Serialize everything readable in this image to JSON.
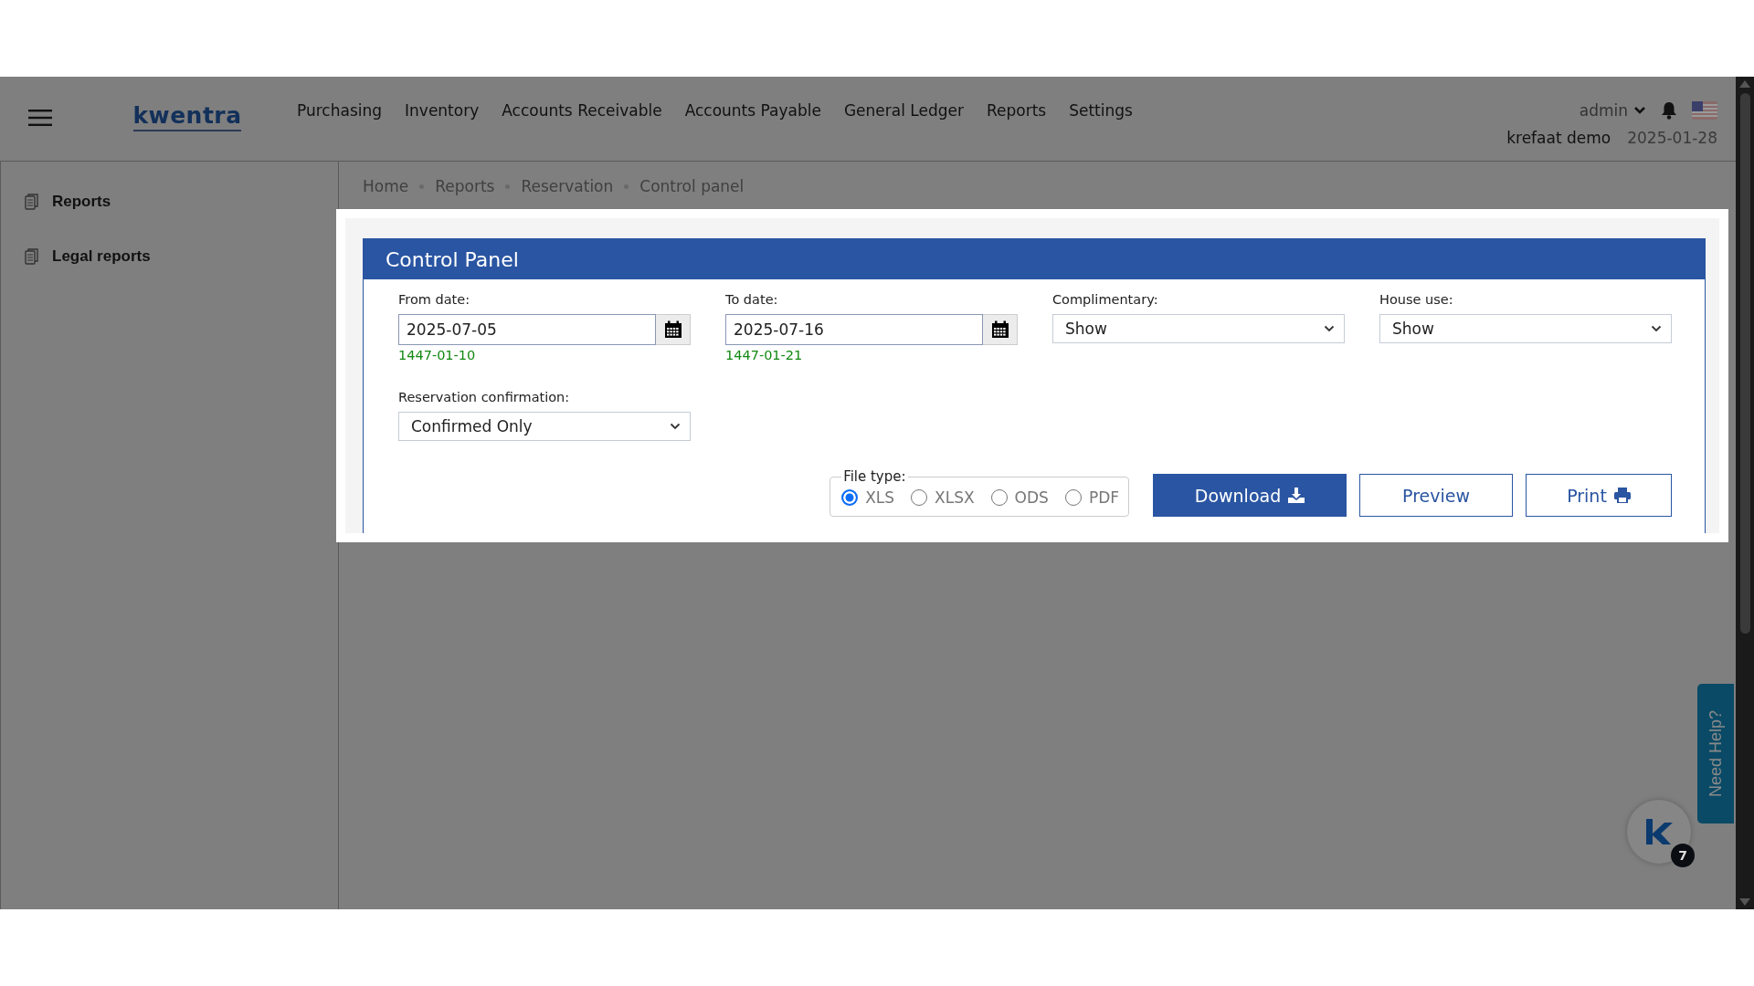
{
  "header": {
    "brand": "kwentra",
    "nav": [
      "Purchasing",
      "Inventory",
      "Accounts Receivable",
      "Accounts Payable",
      "General Ledger",
      "Reports",
      "Settings"
    ],
    "user": "admin",
    "company": "krefaat demo",
    "date": "2025-01-28"
  },
  "sidebar": {
    "items": [
      {
        "label": "Reports"
      },
      {
        "label": "Legal reports"
      }
    ]
  },
  "breadcrumb": [
    "Home",
    "Reports",
    "Reservation",
    "Control panel"
  ],
  "panel": {
    "title": "Control Panel",
    "date_fields": [
      {
        "label": "From date:",
        "value": "2025-07-05",
        "hijri": "1447-01-10"
      },
      {
        "label": "To date:",
        "value": "2025-07-16",
        "hijri": "1447-01-21"
      }
    ],
    "selects": [
      {
        "label": "Complimentary:",
        "value": "Show"
      },
      {
        "label": "House use:",
        "value": "Show"
      }
    ],
    "reservation_confirmation": {
      "label": "Reservation confirmation:",
      "value": "Confirmed Only"
    },
    "file_type": {
      "legend": "File type:",
      "options": [
        {
          "label": "XLS",
          "selected": true
        },
        {
          "label": "XLSX",
          "selected": false
        },
        {
          "label": "ODS",
          "selected": false
        },
        {
          "label": "PDF",
          "selected": false
        }
      ]
    },
    "buttons": [
      {
        "label": "Download",
        "kind": "download"
      },
      {
        "label": "Preview",
        "kind": "preview"
      },
      {
        "label": "Print",
        "kind": "print"
      }
    ]
  },
  "help_tab": {
    "label": "Need Help?"
  },
  "chat": {
    "badge": "7"
  }
}
